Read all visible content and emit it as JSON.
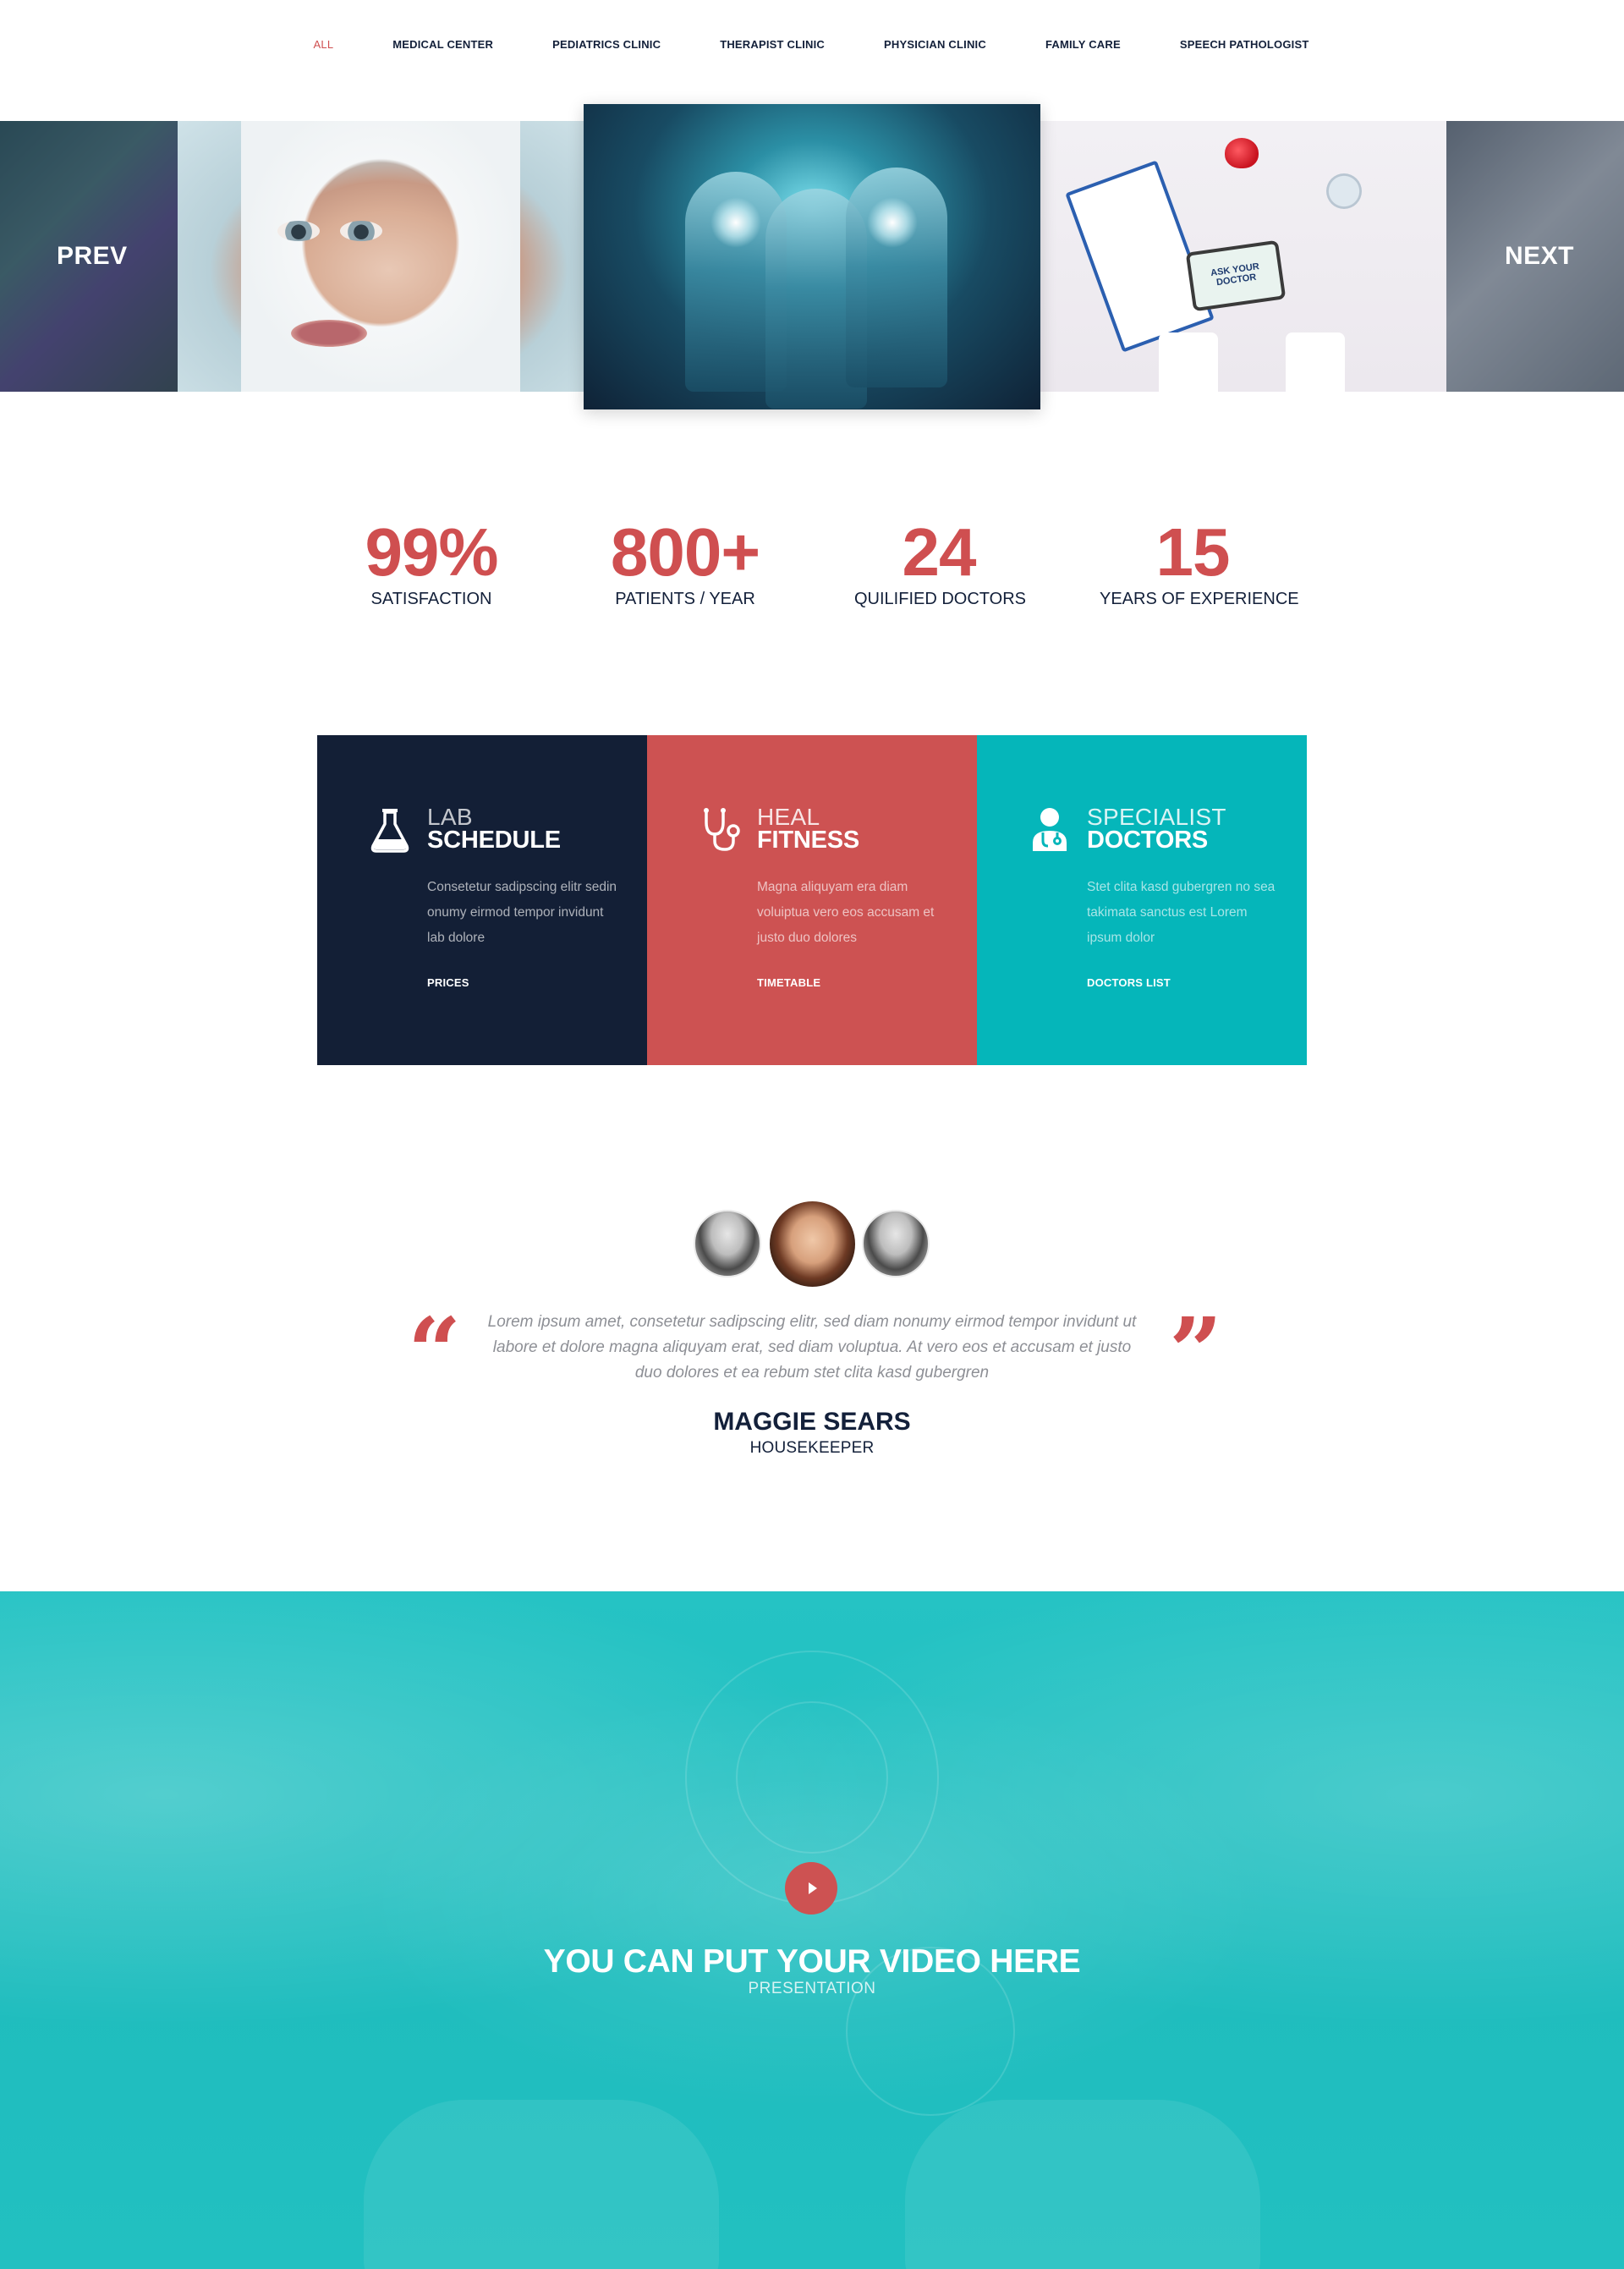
{
  "nav": {
    "items": [
      {
        "label": "ALL",
        "active": true
      },
      {
        "label": "MEDICAL CENTER"
      },
      {
        "label": "PEDIATRICS CLINIC"
      },
      {
        "label": "THERAPIST CLINIC"
      },
      {
        "label": "PHYSICIAN CLINIC"
      },
      {
        "label": "FAMILY CARE"
      },
      {
        "label": "SPEECH PATHOLOGIST"
      }
    ]
  },
  "gallery": {
    "prev_label": "PREV",
    "next_label": "NEXT",
    "tablet_text": "ASK YOUR DOCTOR"
  },
  "stats": [
    {
      "value": "99%",
      "label": "SATISFACTION"
    },
    {
      "value": "800+",
      "label": "PATIENTS / YEAR"
    },
    {
      "value": "24",
      "label": "QUILIFIED DOCTORS"
    },
    {
      "value": "15",
      "label": "YEARS OF EXPERIENCE"
    }
  ],
  "services": [
    {
      "icon": "flask-icon",
      "title_light": "LAB",
      "title_bold": "SCHEDULE",
      "text": "Consetetur sadipscing elitr sedin onumy eirmod tempor invidunt lab dolore",
      "link": "PRICES",
      "color": "#131f36"
    },
    {
      "icon": "stethoscope-icon",
      "title_light": "HEAL",
      "title_bold": "FITNESS",
      "text": "Magna aliquyam era diam voluiptua vero eos accusam et justo duo dolores",
      "link": "TIMETABLE",
      "color": "#cd5252"
    },
    {
      "icon": "doctor-icon",
      "title_light": "SPECIALIST",
      "title_bold": "DOCTORS",
      "text": "Stet clita kasd gubergren no sea takimata sanctus est Lorem ipsum dolor",
      "link": "DOCTORS LIST",
      "color": "#05b6ba"
    }
  ],
  "testimonial": {
    "text": "Lorem ipsum amet, consetetur sadipscing elitr, sed diam nonumy eirmod tempor invidunt ut labore et dolore magna aliquyam erat, sed diam voluptua. At vero eos et accusam et justo duo dolores et ea rebum stet clita kasd gubergren",
    "name": "MAGGIE SEARS",
    "role": "HOUSEKEEPER",
    "quote_open": "“",
    "quote_close": "”"
  },
  "video": {
    "title": "YOU CAN PUT YOUR VIDEO HERE",
    "subtitle": "PRESENTATION"
  },
  "colors": {
    "accent_red": "#cd5252",
    "navy": "#131f36",
    "teal": "#05b6ba"
  }
}
